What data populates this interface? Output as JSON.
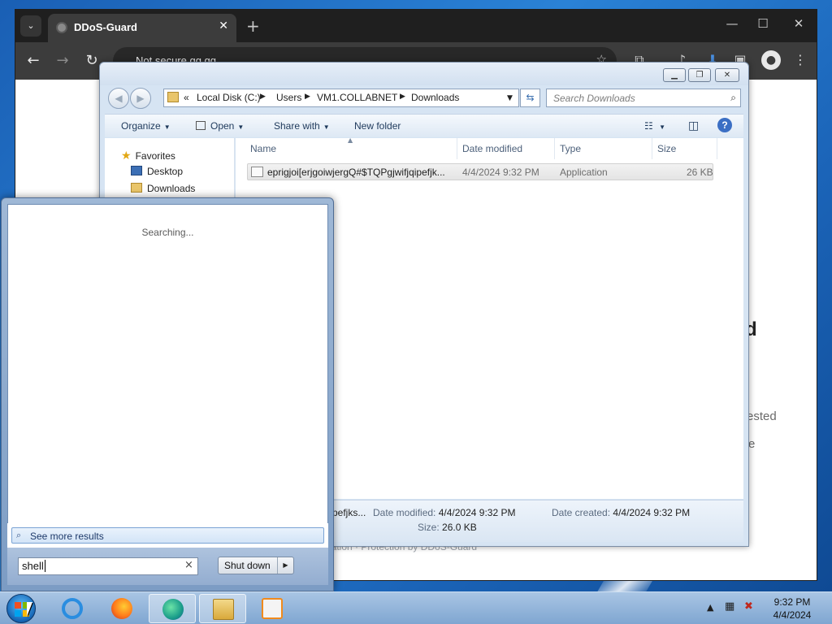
{
  "browser": {
    "tab_title": "DDoS-Guard",
    "tab_close": "✕",
    "new_tab": "+",
    "omnibox_text": "Not secure   gg.gg",
    "page_fragments": {
      "heading_tail": "d",
      "line1_tail": "ested",
      "line2_tail": "e",
      "footer": "ication · Protection by DDoS-Guard"
    }
  },
  "explorer": {
    "breadcrumb": [
      "«",
      "Local Disk (C:)",
      "Users",
      "VM1.COLLABNET",
      "Downloads"
    ],
    "search_placeholder": "Search Downloads",
    "commands": {
      "organize": "Organize",
      "open": "Open",
      "share_with": "Share with",
      "new_folder": "New folder"
    },
    "nav": {
      "favorites": "Favorites",
      "desktop": "Desktop",
      "downloads": "Downloads"
    },
    "columns": {
      "name": "Name",
      "date_modified": "Date modified",
      "type": "Type",
      "size": "Size"
    },
    "files": [
      {
        "name": "eprigjoi[erjgoiwjergQ#$TQPgjwifjqipefjk...",
        "date_modified": "4/4/2024 9:32 PM",
        "type": "Application",
        "size": "26 KB"
      }
    ],
    "details": {
      "name_tail": "pefjks...",
      "date_modified_label": "Date modified:",
      "date_modified_value": "4/4/2024 9:32 PM",
      "date_created_label": "Date created:",
      "date_created_value": "4/4/2024 9:32 PM",
      "size_label": "Size:",
      "size_value": "26.0 KB"
    }
  },
  "start_menu": {
    "status": "Searching...",
    "see_more": "See more results",
    "search_value": "shell",
    "clear": "×",
    "shutdown_label": "Shut down"
  },
  "taskbar": {
    "clock_time": "9:32 PM",
    "clock_date": "4/4/2024"
  }
}
